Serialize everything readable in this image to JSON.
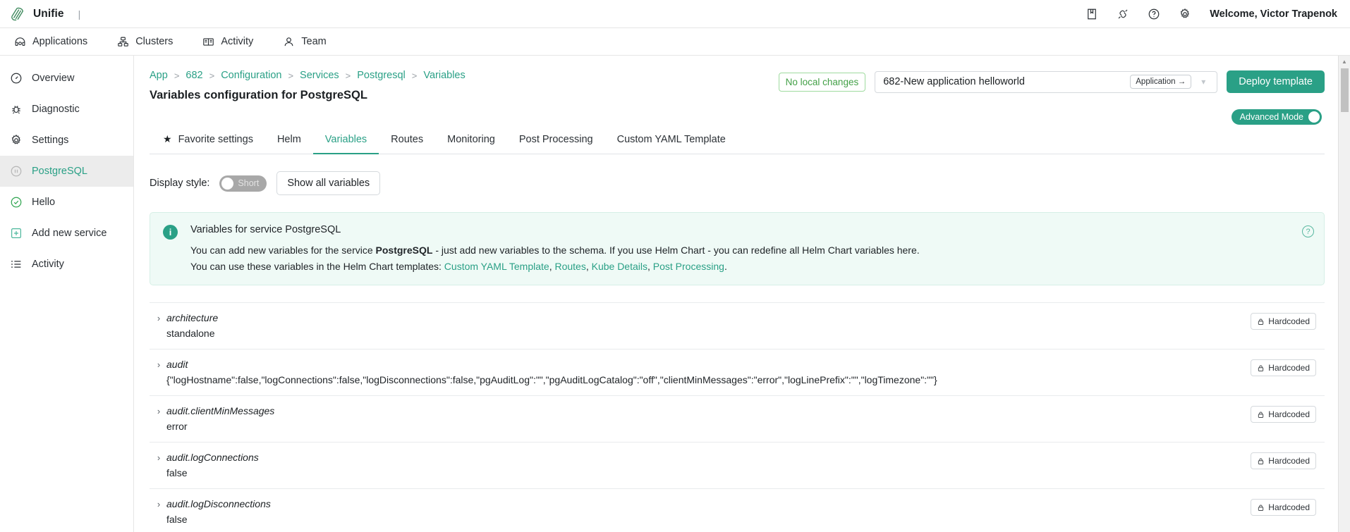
{
  "topbar": {
    "brand": "Unifie",
    "separator": "|",
    "icons": [
      {
        "name": "book-icon"
      },
      {
        "name": "plug-icon"
      },
      {
        "name": "help-circle-icon"
      },
      {
        "name": "gear-icon"
      }
    ],
    "welcome": "Welcome, Victor Trapenok"
  },
  "nav": {
    "items": [
      {
        "label": "Applications",
        "icon": "applications-icon"
      },
      {
        "label": "Clusters",
        "icon": "clusters-icon"
      },
      {
        "label": "Activity",
        "icon": "activity-book-icon"
      },
      {
        "label": "Team",
        "icon": "team-person-icon"
      }
    ]
  },
  "sidebar": {
    "items": [
      {
        "label": "Overview",
        "icon": "gauge-icon",
        "active": false
      },
      {
        "label": "Diagnostic",
        "icon": "bug-icon",
        "active": false
      },
      {
        "label": "Settings",
        "icon": "gear-icon",
        "active": false
      },
      {
        "label": "PostgreSQL",
        "icon": "pause-circle-icon",
        "active": true
      },
      {
        "label": "Hello",
        "icon": "check-circle-icon",
        "active": false
      },
      {
        "label": "Add new service",
        "icon": "plus-square-icon",
        "active": false
      },
      {
        "label": "Activity",
        "icon": "list-icon",
        "active": false
      }
    ]
  },
  "header": {
    "breadcrumb": [
      "App",
      "682",
      "Configuration",
      "Services",
      "Postgresql",
      "Variables"
    ],
    "breadcrumb_separator": ">",
    "page_title": "Variables configuration for PostgreSQL",
    "status_badge": "No local changes",
    "app_select_value": "682-New application helloworld",
    "app_select_chip": "Application →",
    "deploy_button": "Deploy template",
    "advanced_mode_label": "Advanced Mode"
  },
  "tabs": [
    {
      "label": "Favorite settings",
      "icon": "star-icon",
      "active": false
    },
    {
      "label": "Helm",
      "active": false
    },
    {
      "label": "Variables",
      "active": true
    },
    {
      "label": "Routes",
      "active": false
    },
    {
      "label": "Monitoring",
      "active": false
    },
    {
      "label": "Post Processing",
      "active": false
    },
    {
      "label": "Custom YAML Template",
      "active": false
    }
  ],
  "controls": {
    "display_style_label": "Display style:",
    "short_toggle_label": "Short",
    "show_all_button": "Show all variables"
  },
  "info": {
    "title": "Variables for service PostgreSQL",
    "line1_prefix": "You can add new variables for the service ",
    "line1_bold": "PostgreSQL",
    "line1_suffix": " - just add new variables to the schema. If you use Helm Chart - you can redefine all Helm Chart variables here.",
    "line2_prefix": "You can use these variables in the Helm Chart templates: ",
    "line2_links": [
      "Custom YAML Template",
      "Routes",
      "Kube Details",
      "Post Processing"
    ],
    "line2_suffix": ".",
    "help_icon_label": "?"
  },
  "variables": {
    "badge_label": "Hardcoded",
    "caret": "›",
    "rows": [
      {
        "key": "architecture",
        "value": "standalone",
        "badge": "Hardcoded"
      },
      {
        "key": "audit",
        "value": "{\"logHostname\":false,\"logConnections\":false,\"logDisconnections\":false,\"pgAuditLog\":\"\",\"pgAuditLogCatalog\":\"off\",\"clientMinMessages\":\"error\",\"logLinePrefix\":\"\",\"logTimezone\":\"\"}",
        "badge": "Hardcoded"
      },
      {
        "key": "audit.clientMinMessages",
        "value": "error",
        "badge": "Hardcoded"
      },
      {
        "key": "audit.logConnections",
        "value": "false",
        "badge": "Hardcoded"
      },
      {
        "key": "audit.logDisconnections",
        "value": "false",
        "badge": "Hardcoded"
      }
    ]
  },
  "colors": {
    "accent": "#2aa086",
    "banner_bg": "#effaf6",
    "success": "#43a047",
    "sidebar_active_bg": "#ececec"
  }
}
